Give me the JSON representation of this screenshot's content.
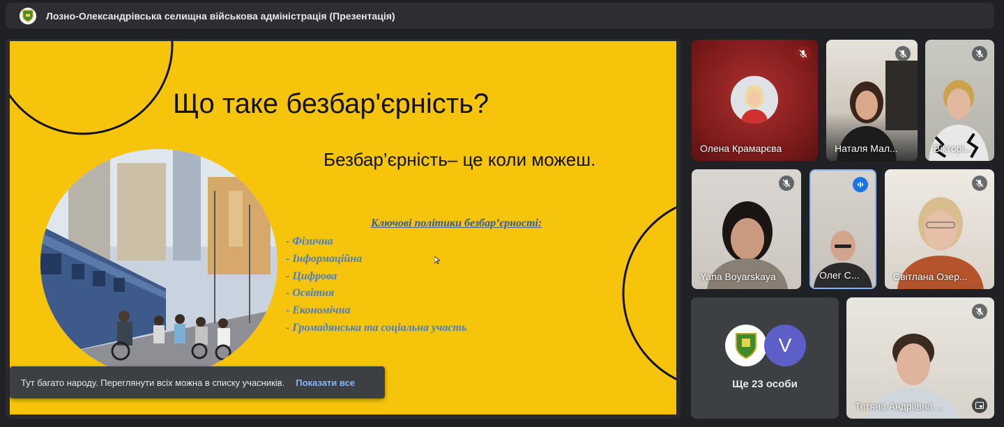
{
  "window": {
    "title": "Лозно-Олександрівська селищна військова адміністрація (Презентація)"
  },
  "slide": {
    "title": "Що таке безбар'єрність?",
    "subtitle": "Безбар’єрність– це коли можеш.",
    "policies_heading": "Ключові політики безбар’єрності:",
    "policies": [
      "- Фізична",
      "- Інформаційна",
      "- Цифрова",
      "- Освітня",
      "- Економічна",
      "- Громадянська та соціальна участь"
    ],
    "background_color": "#f5c40b"
  },
  "toast": {
    "message": "Тут багато народу. Переглянути всіх можна в списку учасників.",
    "action": "Показати все"
  },
  "participants": [
    {
      "name": "Олена Крамарєва",
      "mic": "muted-red"
    },
    {
      "name": "Наталя Мал...",
      "mic": "muted"
    },
    {
      "name": "Вікторі...",
      "mic": "muted"
    },
    {
      "name": "Yana Boyarskaya",
      "mic": "muted"
    },
    {
      "name": "Олег С...",
      "mic": "speaking"
    },
    {
      "name": "Світлана Озер...",
      "mic": "muted"
    },
    {
      "name": "Тетяна Андріївна ...",
      "mic": "muted"
    }
  ],
  "more": {
    "avatar_letter": "V",
    "label": "Ще 23 особи"
  },
  "colors": {
    "accent_blue": "#8ab4f8",
    "speaking_blue": "#1a73e8",
    "muted_red": "#8c1d18"
  }
}
